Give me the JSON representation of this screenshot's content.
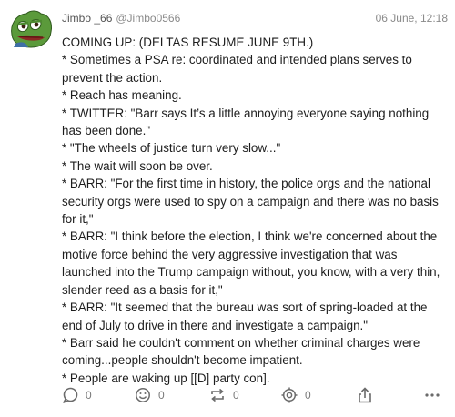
{
  "post": {
    "author_name": "Jimbo _66",
    "author_handle": "@Jimbo0566",
    "timestamp": "06 June, 12:18",
    "avatar_icon": "pepe-frog-avatar",
    "lines": [
      "COMING UP: (DELTAS RESUME JUNE 9TH.)",
      "* Sometimes a PSA re: coordinated and intended plans serves to prevent the action.",
      "* Reach has meaning.",
      "* TWITTER: \"Barr says It’s a little annoying everyone saying nothing has been done.\"",
      "* \"The wheels of justice turn very slow...\"",
      "* The wait will soon be over.",
      "* BARR: \"For the first time in history, the police orgs and the national security orgs were used to spy on a campaign and there was no basis for it,\"",
      "* BARR: \"I think before the election, I think we're concerned about the motive force behind the very aggressive investigation that was launched into the Trump campaign without, you know, with a very thin, slender reed as a basis for it,\"",
      "* BARR: \"It seemed that the bureau was sort of spring-loaded at the end of July to drive in there and investigate a campaign.\"",
      "* Barr said he couldn't comment on whether criminal charges were coming...people shouldn't become impatient.",
      "* People are waking up [[D] party con]."
    ]
  },
  "actions": {
    "reply_count": "0",
    "reaction_count": "0",
    "repost_count": "0",
    "target_count": "0",
    "reply_icon": "speech-bubble-icon",
    "reaction_icon": "smiley-icon",
    "repost_icon": "repost-arrows-icon",
    "target_icon": "crosshair-icon",
    "share_icon": "share-icon",
    "more_icon": "more-dots-icon"
  },
  "colors": {
    "text": "#1d1d1d",
    "meta": "#8a8a8a",
    "icon": "#6b6b6b",
    "avatar_green": "#5a9a3a"
  }
}
